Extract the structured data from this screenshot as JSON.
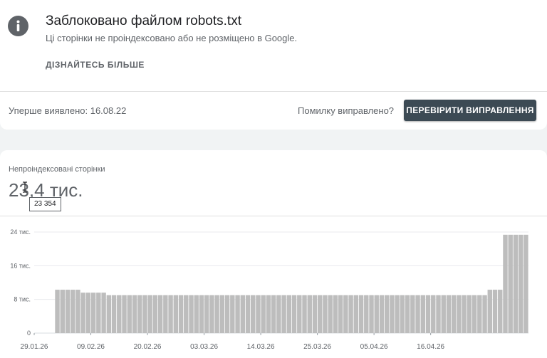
{
  "issue": {
    "title": "Заблоковано файлом robots.txt",
    "subtitle": "Ці сторінки не проіндексовано або не розміщено в Google.",
    "learn_more": "ДІЗНАЙТЕСЬ БІЛЬШЕ",
    "first_detected": "Уперше виявлено: 16.08.22",
    "fixed_question": "Помилку виправлено?",
    "validate_button": "ПЕРЕВІРИТИ ВИПРАВЛЕННЯ",
    "icon": "info-icon"
  },
  "metric": {
    "label": "Непроіндексовані сторінки",
    "value": "23,4 тис.",
    "tooltip": "23 354"
  },
  "colors": {
    "bar": "#bdbdbd",
    "grid": "#e8eaed",
    "button_bg": "#3c4a54",
    "icon": "#5f6368"
  },
  "chart_data": {
    "type": "bar",
    "y_ticks": [
      {
        "value": 0,
        "label": "0"
      },
      {
        "value": 8000,
        "label": "8 тис."
      },
      {
        "value": 16000,
        "label": "16 тис."
      },
      {
        "value": 24000,
        "label": "24 тис."
      }
    ],
    "x_ticks": [
      {
        "index": 0,
        "label": "29.01.26"
      },
      {
        "index": 11,
        "label": "09.02.26"
      },
      {
        "index": 22,
        "label": "20.02.26"
      },
      {
        "index": 33,
        "label": "03.03.26"
      },
      {
        "index": 44,
        "label": "14.03.26"
      },
      {
        "index": 55,
        "label": "25.03.26"
      },
      {
        "index": 66,
        "label": "05.04.26"
      },
      {
        "index": 77,
        "label": "16.04.26"
      }
    ],
    "ylim": [
      0,
      24000
    ],
    "grid": true,
    "values": [
      null,
      null,
      null,
      null,
      10300,
      10300,
      10300,
      10300,
      10300,
      9600,
      9600,
      9600,
      9600,
      9600,
      9000,
      9000,
      9000,
      9000,
      9000,
      9000,
      9000,
      9000,
      9000,
      9000,
      9000,
      9000,
      9000,
      9000,
      9000,
      9000,
      9000,
      9000,
      9000,
      9000,
      9000,
      9000,
      9000,
      9000,
      9000,
      9000,
      9000,
      9000,
      9000,
      9000,
      9000,
      9000,
      9000,
      9000,
      9000,
      9000,
      9000,
      9000,
      9000,
      9000,
      9000,
      9000,
      9000,
      9000,
      9000,
      9000,
      9000,
      9000,
      9000,
      9000,
      9000,
      9000,
      9000,
      9000,
      9000,
      9000,
      9000,
      9000,
      9000,
      9000,
      9000,
      9000,
      9000,
      9000,
      9000,
      9000,
      9000,
      9000,
      9000,
      9000,
      9000,
      9000,
      9000,
      9000,
      10300,
      10300,
      10300,
      23354,
      23354,
      23354,
      23354,
      23354
    ]
  }
}
